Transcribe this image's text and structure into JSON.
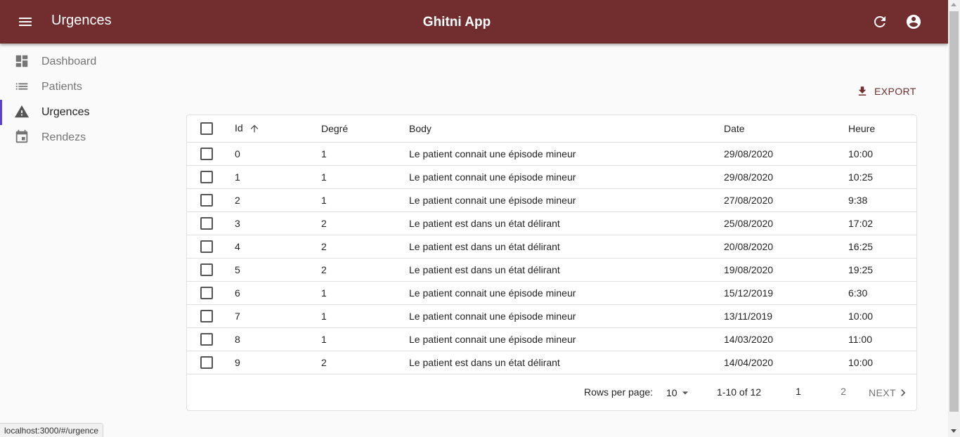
{
  "appbar": {
    "page_title": "Urgences",
    "app_name": "Ghitni App",
    "color": "#722d2f"
  },
  "sidebar": {
    "items": [
      {
        "label": "Dashboard",
        "icon": "dashboard-icon"
      },
      {
        "label": "Patients",
        "icon": "list-icon"
      },
      {
        "label": "Urgences",
        "icon": "warning-icon",
        "active": true
      },
      {
        "label": "Rendezs",
        "icon": "calendar-icon"
      }
    ]
  },
  "toolbar": {
    "export_label": "EXPORT"
  },
  "table": {
    "columns": [
      "Id",
      "Degré",
      "Body",
      "Date",
      "Heure"
    ],
    "sort": {
      "column": "Id",
      "direction": "asc"
    },
    "rows": [
      [
        "0",
        "1",
        "Le patient connait une épisode mineur",
        "29/08/2020",
        "10:00"
      ],
      [
        "1",
        "1",
        "Le patient connait une épisode mineur",
        "29/08/2020",
        "10:25"
      ],
      [
        "2",
        "1",
        "Le patient connait une épisode mineur",
        "27/08/2020",
        "9:38"
      ],
      [
        "3",
        "2",
        "Le patient est dans un état délirant",
        "25/08/2020",
        "17:02"
      ],
      [
        "4",
        "2",
        "Le patient est dans un état délirant",
        "20/08/2020",
        "16:25"
      ],
      [
        "5",
        "2",
        "Le patient est dans un état délirant",
        "19/08/2020",
        "19:25"
      ],
      [
        "6",
        "1",
        "Le patient connait une épisode mineur",
        "15/12/2019",
        "6:30"
      ],
      [
        "7",
        "1",
        "Le patient connait une épisode mineur",
        "13/11/2019",
        "10:00"
      ],
      [
        "8",
        "1",
        "Le patient connait une épisode mineur",
        "14/03/2020",
        "11:00"
      ],
      [
        "9",
        "2",
        "Le patient est dans un état délirant",
        "14/04/2020",
        "10:00"
      ]
    ]
  },
  "pagination": {
    "rows_per_page_label": "Rows per page:",
    "rows_per_page": "10",
    "range": "1-10 of 12",
    "pages": [
      "1",
      "2"
    ],
    "current_page": "1",
    "next_label": "NEXT"
  },
  "statusbar": {
    "url": "localhost:3000/#/urgence"
  }
}
